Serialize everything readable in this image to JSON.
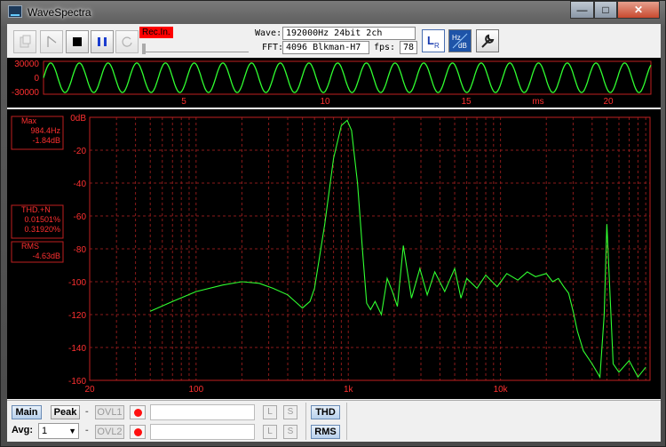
{
  "window": {
    "title": "WaveSpectra",
    "min_glyph": "—",
    "max_glyph": "□",
    "close_glyph": "✕"
  },
  "toolbar": {
    "rec_label": "Rec.In.",
    "wave_label": "Wave:",
    "wave_value": "192000Hz 24bit 2ch",
    "fft_label": "FFT:",
    "fft_value": "4096 Blkman-H7",
    "fps_label": "fps:",
    "fps_value": "78"
  },
  "scope": {
    "y_ticks": [
      "30000",
      "0",
      "-30000"
    ],
    "x_ticks": [
      "5",
      "10",
      "15",
      "20"
    ],
    "x_unit": "ms"
  },
  "spectrum": {
    "y_ticks": [
      "0dB",
      "-20",
      "-40",
      "-60",
      "-80",
      "-100",
      "-120",
      "-140",
      "-160"
    ],
    "x_ticks": [
      "20",
      "100",
      "1k",
      "10k"
    ],
    "max_label": "Max",
    "max_freq": "984.4Hz",
    "max_level": "-1.84dB",
    "thd_label": "THD.+N",
    "thd_value1": "0.01501%",
    "thd_value2": "0.31920%",
    "rms_label": "RMS",
    "rms_value": "-4.63dB"
  },
  "bottom": {
    "main": "Main",
    "peak": "Peak",
    "dash1": "-",
    "ovl1": "OVL1",
    "avg_label": "Avg:",
    "avg_value": "1",
    "dash2": "-",
    "ovl2": "OVL2",
    "l": "L",
    "s": "S",
    "thd": "THD",
    "rms": "RMS"
  },
  "chart_data": [
    {
      "type": "line",
      "title": "",
      "xlabel": "ms",
      "ylabel": "",
      "xlim": [
        0,
        21.5
      ],
      "ylim": [
        -30000,
        30000
      ],
      "series": [
        {
          "kind": "sine",
          "amplitude": 27000,
          "frequency_hz": 984.4
        }
      ]
    },
    {
      "type": "line",
      "title": "",
      "xlabel": "",
      "ylabel": "dB",
      "x_scale": "log",
      "xlim": [
        20,
        96000
      ],
      "ylim": [
        -160,
        0
      ],
      "grid": true,
      "x": [
        50,
        70,
        100,
        150,
        200,
        260,
        320,
        400,
        460,
        500,
        560,
        600,
        700,
        800,
        900,
        984,
        1050,
        1150,
        1250,
        1320,
        1400,
        1500,
        1650,
        1800,
        1950,
        2100,
        2300,
        2600,
        2950,
        3300,
        3700,
        4300,
        5000,
        5500,
        6000,
        7000,
        8000,
        9500,
        11000,
        13000,
        15000,
        17000,
        20000,
        22000,
        24000,
        26000,
        28000,
        30000,
        32000,
        35000,
        40000,
        45000,
        48000,
        50000,
        55000,
        60000,
        70000,
        80000,
        90000
      ],
      "y": [
        -118,
        -112,
        -106,
        -102,
        -100,
        -101,
        -104,
        -108,
        -113,
        -116,
        -112,
        -104,
        -65,
        -25,
        -5,
        -1.84,
        -8,
        -40,
        -85,
        -113,
        -117,
        -112,
        -120,
        -98,
        -106,
        -115,
        -78,
        -110,
        -92,
        -108,
        -94,
        -106,
        -92,
        -110,
        -98,
        -104,
        -96,
        -103,
        -95,
        -99,
        -94,
        -97,
        -95,
        -100,
        -98,
        -103,
        -107,
        -118,
        -130,
        -142,
        -150,
        -158,
        -120,
        -65,
        -150,
        -155,
        -148,
        -158,
        -152
      ]
    }
  ]
}
